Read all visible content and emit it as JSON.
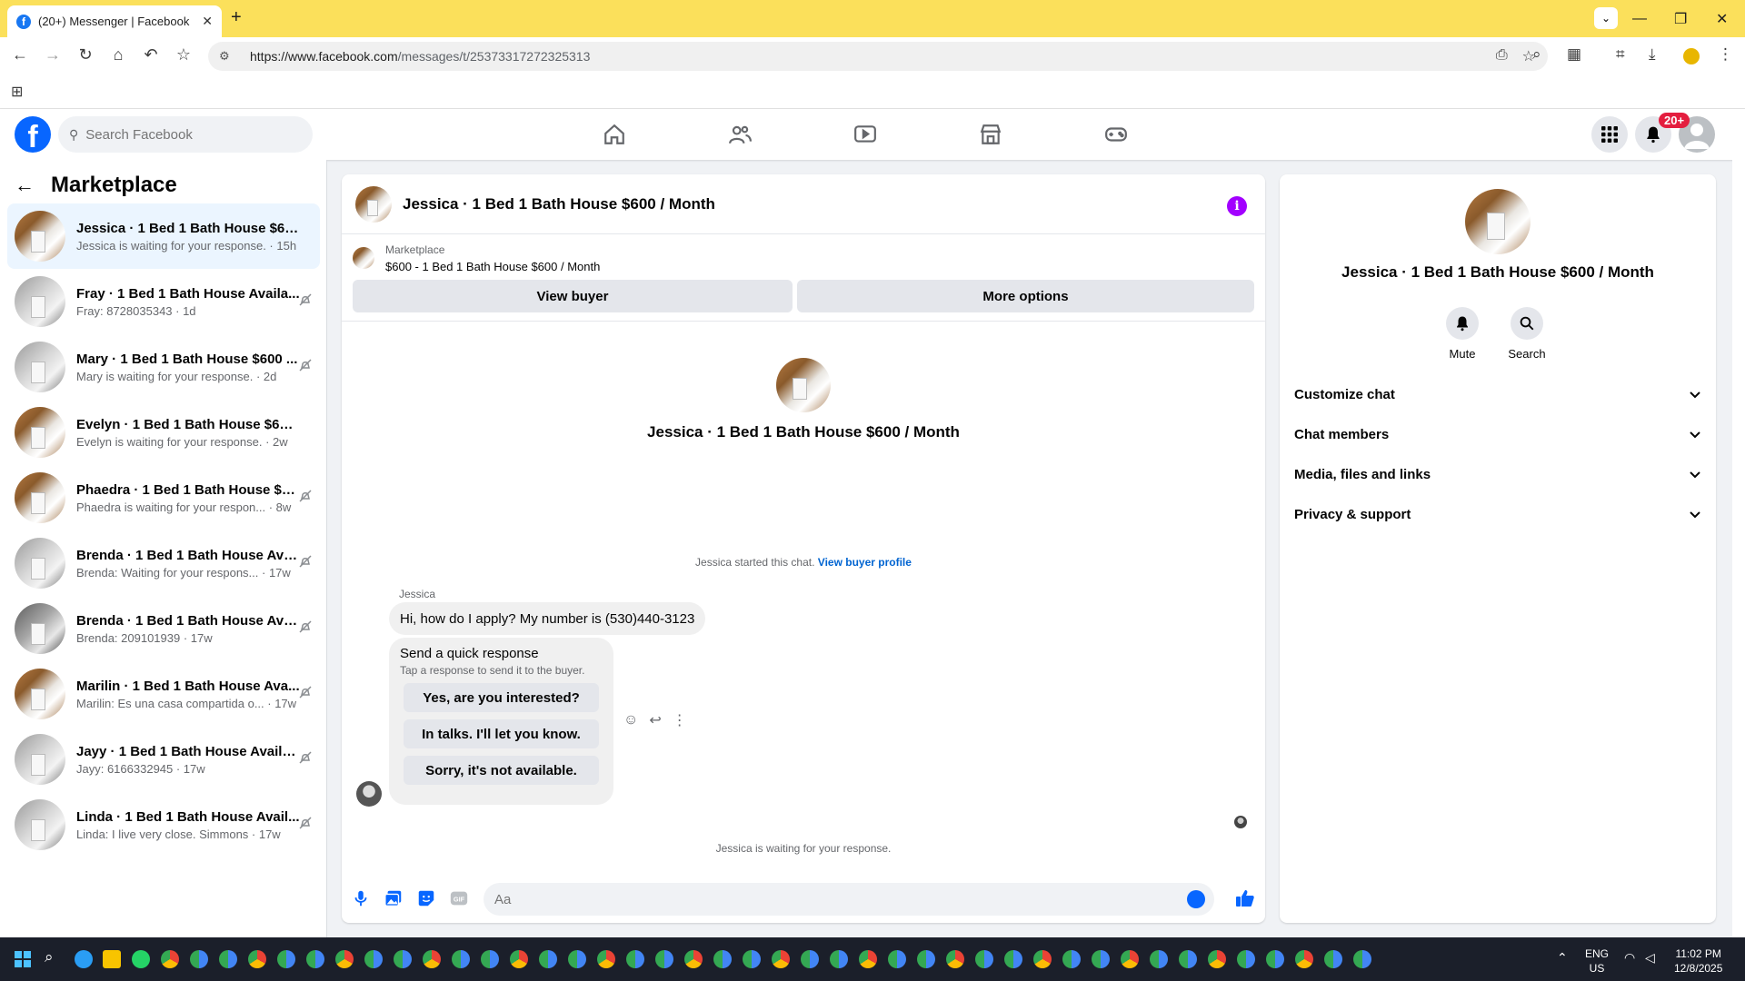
{
  "browser": {
    "tab_title": "(20+) Messenger | Facebook",
    "tab_favicon": "f",
    "url_host": "https://www.facebook.com",
    "url_path": "/messages/t/25373317272325313"
  },
  "header": {
    "logo_letter": "f",
    "search_placeholder": "Search Facebook",
    "notification_count": "20+"
  },
  "left": {
    "title": "Marketplace",
    "conversations": [
      {
        "name": "Jessica · 1 Bed 1 Bath House $600 /...",
        "sub": "Jessica is waiting for your response. · 15h",
        "active": true
      },
      {
        "name": "Fray · 1 Bed 1 Bath House Availa...",
        "sub": "Fray: 8728035343 · 1d"
      },
      {
        "name": "Mary · 1 Bed 1 Bath House $600 ...",
        "sub": "Mary is waiting for your response. · 2d"
      },
      {
        "name": "Evelyn · 1 Bed 1 Bath House $600 /...",
        "sub": "Evelyn is waiting for your response. · 2w"
      },
      {
        "name": "Phaedra · 1 Bed 1 Bath House $6...",
        "sub": "Phaedra is waiting for your respon... · 8w"
      },
      {
        "name": "Brenda · 1 Bed 1 Bath House Ava...",
        "sub": "Brenda: Waiting for your respons... · 17w"
      },
      {
        "name": "Brenda · 1 Bed 1 Bath House Ava...",
        "sub": "Brenda: 209101939 · 17w"
      },
      {
        "name": "Marilin · 1 Bed 1 Bath House Ava...",
        "sub": "Marilin: Es una casa compartida o... · 17w"
      },
      {
        "name": "Jayy · 1 Bed 1 Bath House Availa...",
        "sub": "Jayy: 6166332945 · 17w"
      },
      {
        "name": "Linda · 1 Bed 1 Bath House Avail...",
        "sub": "Linda: I live very close. Simmons · 17w"
      }
    ]
  },
  "chat": {
    "title": "Jessica · 1 Bed 1 Bath House $600 / Month",
    "info_glyph": "i",
    "marketplace_label": "Marketplace",
    "listing_price": "$600 - 1 Bed 1 Bath House $600 / Month",
    "view_buyer": "View buyer",
    "more_options": "More options",
    "center_name": "Jessica · 1 Bed 1 Bath House $600 / Month",
    "started_text": "Jessica started this chat.",
    "view_buyer_profile": "View buyer profile",
    "sender": "Jessica",
    "message": "Hi, how do I apply? My number is (530)440-3123",
    "quick_title": "Send a quick response",
    "quick_sub": "Tap a response to send it to the buyer.",
    "quick_replies": [
      "Yes, are you interested?",
      "In talks. I'll let you know.",
      "Sorry, it's not available."
    ],
    "waiting": "Jessica is waiting for your response.",
    "composer_placeholder": "Aa"
  },
  "right": {
    "name": "Jessica · 1 Bed 1 Bath House $600 / Month",
    "mute": "Mute",
    "search": "Search",
    "sections": [
      "Customize chat",
      "Chat members",
      "Media, files and links",
      "Privacy & support"
    ]
  },
  "tray": {
    "lang_top": "ENG",
    "lang_bottom": "US",
    "time": "11:02 PM",
    "date": "12/8/2025"
  },
  "colors": {
    "fb_blue": "#0866ff",
    "chrome_yellow": "#fbe05b",
    "info_purple": "#a200ff",
    "badge_red": "#e41e3f"
  }
}
